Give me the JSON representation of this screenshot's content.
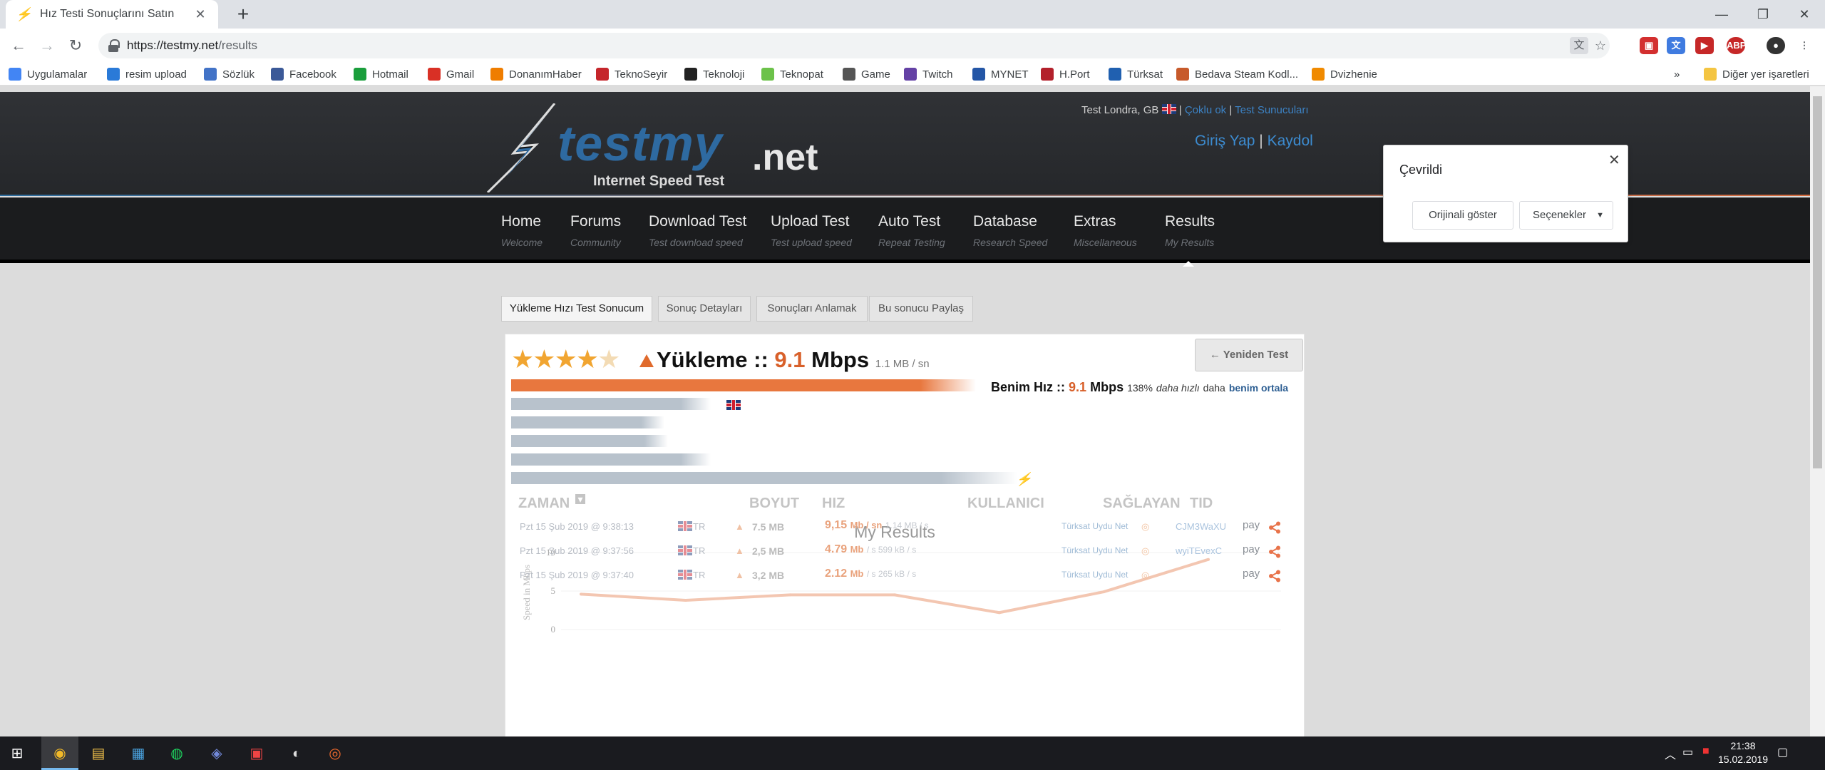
{
  "browser": {
    "tab_title": "Hız Testi Sonuçlarını Satın",
    "new_tab_glyph": "+",
    "url_host": "https://testmy.net",
    "url_path": "/results",
    "bookmarks": [
      {
        "label": "Uygulamalar",
        "icon": "apps-grid-icon",
        "color": "#4285f4"
      },
      {
        "label": "resim upload",
        "icon": "image-upload-icon",
        "color": "#2a7ad8"
      },
      {
        "label": "Sözlük",
        "icon": "dictionary-icon",
        "color": "#4273c7"
      },
      {
        "label": "Facebook",
        "icon": "facebook-icon",
        "color": "#3b5998"
      },
      {
        "label": "Hotmail",
        "icon": "windows-icon",
        "color": "#1a9e3c"
      },
      {
        "label": "Gmail",
        "icon": "gmail-icon",
        "color": "#d93025"
      },
      {
        "label": "DonanımHaber",
        "icon": "donanimhaber-icon",
        "color": "#ef7d00"
      },
      {
        "label": "TeknoSeyir",
        "icon": "teknoseyir-icon",
        "color": "#c5262b"
      },
      {
        "label": "Teknoloji",
        "icon": "teknoloji-icon",
        "color": "#222222"
      },
      {
        "label": "Teknopat",
        "icon": "power-icon",
        "color": "#6cc24a"
      },
      {
        "label": "Game",
        "icon": "game-icon",
        "color": "#555555"
      },
      {
        "label": "Twitch",
        "icon": "twitch-icon",
        "color": "#6441a5"
      },
      {
        "label": "MYNET",
        "icon": "mynet-icon",
        "color": "#2456a6"
      },
      {
        "label": "H.Port",
        "icon": "hport-icon",
        "color": "#b3202b"
      },
      {
        "label": "Türksat",
        "icon": "turksat-icon",
        "color": "#2060b0"
      },
      {
        "label": "Bedava Steam Kodl...",
        "icon": "steam-icon",
        "color": "#c75a2b"
      },
      {
        "label": "Dvizhenie",
        "icon": "dvizhenie-icon",
        "color": "#f08a00"
      }
    ],
    "bookmarks_overflow": "»",
    "other_bookmarks": "Diğer yer işaretleri"
  },
  "translate_popup": {
    "title": "Çevrildi",
    "show_original": "Orijinali göster",
    "options": "Seçenekler"
  },
  "site": {
    "logo_word": "testmy",
    "logo_tld": ".net",
    "logo_tagline": "Internet Speed Test",
    "server_text": "Test Londra, GB",
    "multi_link": "Çoklu ok",
    "servers_link": "Test Sunucuları",
    "login": "Giriş Yap",
    "register": "Kaydol",
    "nav": [
      {
        "title": "Home",
        "sub": "Welcome"
      },
      {
        "title": "Forums",
        "sub": "Community"
      },
      {
        "title": "Download Test",
        "sub": "Test download speed"
      },
      {
        "title": "Upload Test",
        "sub": "Test upload speed"
      },
      {
        "title": "Auto Test",
        "sub": "Repeat Testing"
      },
      {
        "title": "Database",
        "sub": "Research Speed"
      },
      {
        "title": "Extras",
        "sub": "Miscellaneous"
      },
      {
        "title": "Results",
        "sub": "My Results"
      }
    ],
    "result_tabs": [
      "Yükleme Hızı Test Sonucum",
      "Sonuç Detayları",
      "Sonuçları Anlamak",
      "Bu sonucu Paylaş"
    ],
    "result": {
      "stars": 4,
      "stars_max": 5,
      "label": "Yükleme ::",
      "value": "9.1",
      "unit": "Mbps",
      "mb_per_sec": "1.1 MB / sn",
      "retest": "← Yeniden Test",
      "my_speed_label": "Benim Hız ::",
      "my_speed_value": "9.1",
      "my_speed_unit": "Mbps",
      "compare_pct": "138%",
      "compare_text": "daha hızlı",
      "compare_word": "daha",
      "compare_link": "benim ortala"
    },
    "table": {
      "headers": [
        "ZAMAN",
        "BOYUT",
        "HIZ",
        "KULLANICI",
        "SAĞLAYAN",
        "TID"
      ],
      "rows": [
        {
          "time": "Pzt 15 Şub 2019 @ 9:38:13",
          "country": "TR",
          "size": "7.5 MB",
          "speed": "9,15",
          "speed_unit": "Mb / sn",
          "kb": "1.14 MB / s",
          "isp": "Türksat Uydu Net",
          "tid": "CJM3WaXU",
          "pay": "pay"
        },
        {
          "time": "Pzt 15 Şub 2019 @ 9:37:56",
          "country": "TR",
          "size": "2,5 MB",
          "speed": "4.79",
          "speed_unit": "Mb",
          "kb": "/ s 599 kB / s",
          "isp": "Türksat Uydu Net",
          "tid": "wyiTEvexC",
          "pay": "pay"
        },
        {
          "time": "Pzt 15 Şub 2019 @ 9:37:40",
          "country": "TR",
          "size": "3,2 MB",
          "speed": "2.12",
          "speed_unit": "Mb",
          "kb": "/ s 265 kB / s",
          "isp": "Türksat Uydu Net",
          "tid": "",
          "pay": "pay"
        }
      ]
    }
  },
  "chart_data": {
    "type": "line",
    "title": "My Results",
    "ylabel": "Speed in Mbps",
    "ylim": [
      0,
      10
    ],
    "yticks": [
      "10",
      "5",
      "0"
    ],
    "series": [
      {
        "values": [
          4.6,
          3.8,
          4.5,
          4.5,
          2.2,
          4.9,
          9.1
        ],
        "color": "#f3c6b1"
      }
    ]
  },
  "taskbar": {
    "time": "21:38",
    "date": "15.02.2019",
    "apps": [
      "start-icon",
      "chrome-icon",
      "file-explorer-icon",
      "store-icon",
      "spotify-icon",
      "discord-icon",
      "voicemeeter-icon",
      "steam-icon",
      "origin-icon"
    ]
  }
}
